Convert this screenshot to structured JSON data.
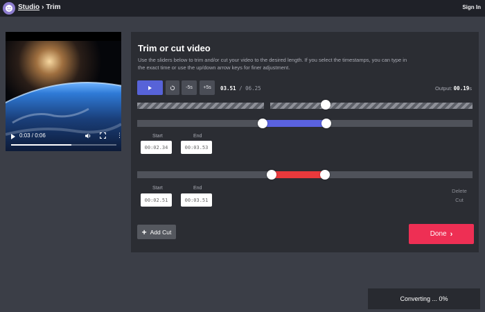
{
  "header": {
    "breadcrumb_studio": "Studio",
    "breadcrumb_separator": "›",
    "breadcrumb_current": "Trim",
    "signin_label": "Sign In",
    "logo_icon": "face-logo-icon",
    "logo_color": "#8d7dcf"
  },
  "video": {
    "time_display": "0:03 / 0:06",
    "progress": 0.57,
    "icons": [
      "play-icon",
      "volume-icon",
      "fullscreen-icon",
      "more-vertical-icon"
    ]
  },
  "editor": {
    "title": "Trim or cut video",
    "description": "Use the sliders below to trim and/or cut your video to the desired length. If you select the timestamps, you can type in the exact time or use the up/down arrow keys for finer adjustment.",
    "controls": {
      "play_icon": "play-icon",
      "replay_icon": "replay-icon",
      "minus_label": "-5s",
      "plus_label": "+5s"
    },
    "current_time": "03.51",
    "time_separator": "/",
    "total_time": "06.25",
    "output_label": "Output:",
    "output_value": "00.19",
    "output_unit": "s",
    "trim": {
      "start_label": "Start",
      "end_label": "End",
      "start_value": "00:02.34",
      "end_value": "00:03.53",
      "color": "#5a62e0"
    },
    "cut": {
      "start_label": "Start",
      "end_label": "End",
      "start_value": "00:02.51",
      "end_value": "00:03.51",
      "delete_label": "Delete Cut",
      "color": "#e8393c"
    },
    "add_cut_label": "Add Cut",
    "add_cut_icon": "plus-icon",
    "done_label": "Done",
    "done_icon": "chevron-right-icon",
    "accent_color": "#ee2f54"
  },
  "status": {
    "converting_label": "Converting ... 0%"
  }
}
